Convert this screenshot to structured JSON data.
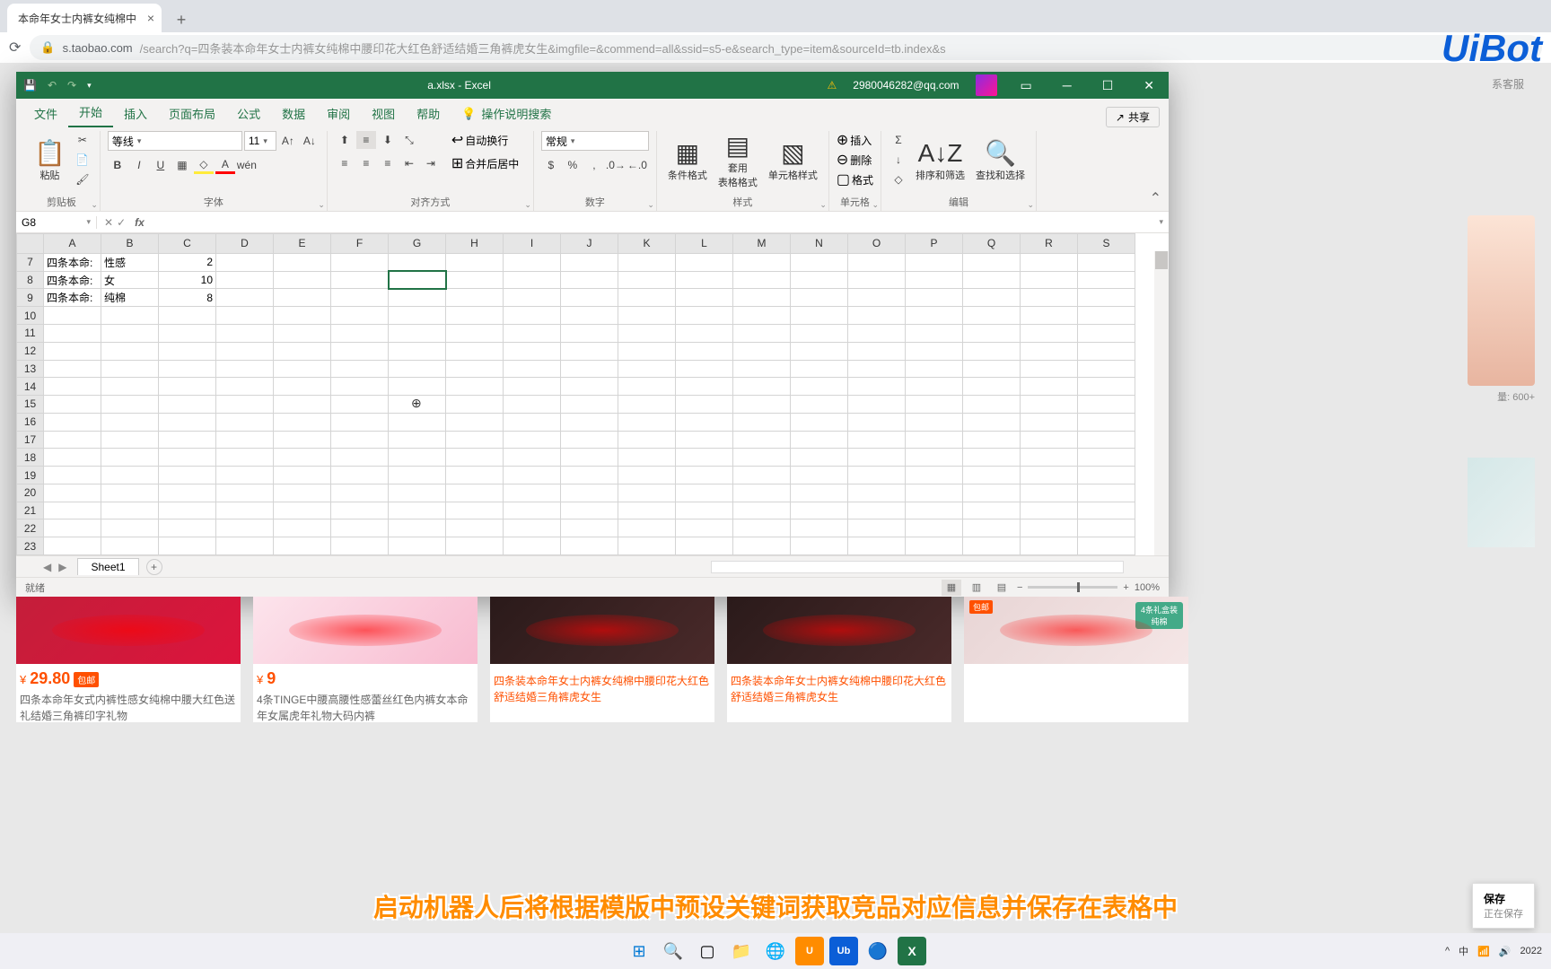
{
  "browser": {
    "tab_title": "本命年女士内裤女纯棉中",
    "url_host": "s.taobao.com",
    "url_path": "/search?q=四条装本命年女士内裤女纯棉中腰印花大红色舒适结婚三角裤虎女生&imgfile=&commend=all&ssid=s5-e&search_type=item&sourceId=tb.index&s",
    "service_link": "系客服"
  },
  "uibot": "UiBot",
  "excel": {
    "title": "a.xlsx - Excel",
    "account": "2980046282@qq.com",
    "tabs": [
      "文件",
      "开始",
      "插入",
      "页面布局",
      "公式",
      "数据",
      "审阅",
      "视图",
      "帮助"
    ],
    "tell_me": "操作说明搜索",
    "share": "共享",
    "groups": {
      "clipboard": "剪贴板",
      "paste": "粘贴",
      "font": "字体",
      "font_name": "等线",
      "font_size": "11",
      "align": "对齐方式",
      "wrap": "自动换行",
      "merge": "合并后居中",
      "number": "数字",
      "number_fmt": "常规",
      "styles": "样式",
      "cond_fmt": "条件格式",
      "table_fmt": "套用\n表格格式",
      "cell_style": "单元格样式",
      "cells": "单元格",
      "insert": "插入",
      "delete": "删除",
      "format": "格式",
      "editing": "编辑",
      "sort": "排序和筛选",
      "find": "查找和选择"
    },
    "namebox": "G8",
    "columns": [
      "A",
      "B",
      "C",
      "D",
      "E",
      "F",
      "G",
      "H",
      "I",
      "J",
      "K",
      "L",
      "M",
      "N",
      "O",
      "P",
      "Q",
      "R",
      "S"
    ],
    "rows": [
      7,
      8,
      9,
      10,
      11,
      12,
      13,
      14,
      15,
      16,
      17,
      18,
      19,
      20,
      21,
      22,
      23
    ],
    "cells": [
      {
        "r": 7,
        "a": "四条本命:",
        "b": "性感",
        "c": "2"
      },
      {
        "r": 8,
        "a": "四条本命:",
        "b": "女",
        "c": "10"
      },
      {
        "r": 9,
        "a": "四条本命:",
        "b": "纯棉",
        "c": "8"
      }
    ],
    "sheet": "Sheet1",
    "status": "就绪",
    "zoom": "100%"
  },
  "products": [
    {
      "price": "29.80",
      "badge": "包邮",
      "title": "四条本命年女式内裤性感女纯棉中腰大红色送礼结婚三角裤印字礼物"
    },
    {
      "price": "9",
      "title": "4条TINGE中腰高腰性感蕾丝红色内裤女本命年女属虎年礼物大码内裤"
    },
    {
      "title": "四条装本命年女士内裤女纯棉中腰印花大红色舒适结婚三角裤虎女生",
      "hl": true
    },
    {
      "title": "四条装本命年女士内裤女纯棉中腰印花大红色舒适结婚三角裤虎女生",
      "hl": true
    },
    {
      "badge": "包邮",
      "note": "4条礼盒装\n纯棉"
    }
  ],
  "side_sales": "量: 600+",
  "subtitle": "启动机器人后将根据模版中预设关键词获取竞品对应信息并保存在表格中",
  "save_toast": {
    "t1": "保存",
    "t2": "正在保存"
  },
  "taskbar": {
    "lang": "中",
    "datetime": "2022"
  }
}
